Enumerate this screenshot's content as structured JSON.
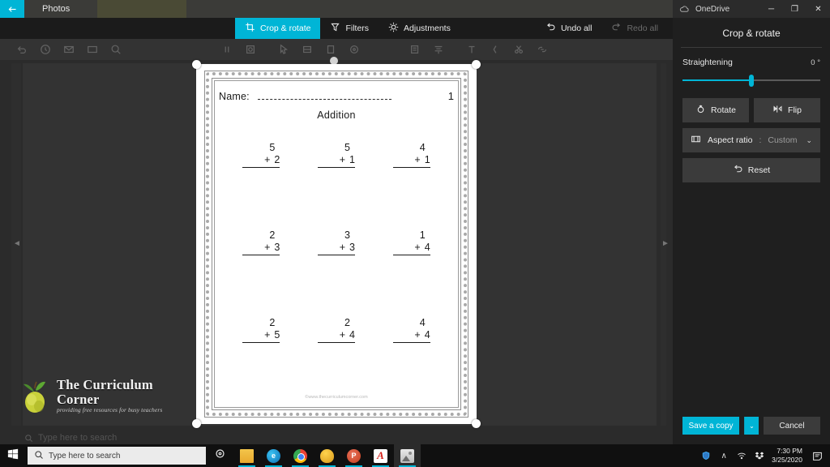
{
  "background_window": {
    "title": "",
    "toolbar_icons": [
      "undo-icon",
      "clock-icon",
      "mail-icon",
      "envelope-icon",
      "search-icon",
      "pause-icon",
      "stamp-icon",
      "cursor-icon",
      "shape-icon",
      "target-icon",
      "note-icon",
      "text-icon",
      "align-icon",
      "bracket-icon",
      "scissors-icon",
      "link-icon"
    ],
    "zoom_label": "",
    "search_ghost_placeholder": "Type here to search"
  },
  "photos": {
    "back_label": "←",
    "app_name": "Photos",
    "tools": [
      {
        "label": "Crop & rotate",
        "icon": "crop-icon",
        "active": true
      },
      {
        "label": "Filters",
        "icon": "filters-icon",
        "active": false
      },
      {
        "label": "Adjustments",
        "icon": "brightness-icon",
        "active": false
      }
    ],
    "actions": [
      {
        "label": "Undo all",
        "icon": "undo-icon",
        "disabled": false
      },
      {
        "label": "Redo all",
        "icon": "redo-icon",
        "disabled": true
      }
    ]
  },
  "worksheet": {
    "name_label": "Name:",
    "name_value": "",
    "page_number": "1",
    "title": "Addition",
    "footer": "©www.thecurriculumcorner.com",
    "rows": [
      [
        {
          "top": "5",
          "op": "+",
          "bottom": "2"
        },
        {
          "top": "5",
          "op": "+",
          "bottom": "1"
        },
        {
          "top": "4",
          "op": "+",
          "bottom": "1"
        }
      ],
      [
        {
          "top": "2",
          "op": "+",
          "bottom": "3"
        },
        {
          "top": "3",
          "op": "+",
          "bottom": "3"
        },
        {
          "top": "1",
          "op": "+",
          "bottom": "4"
        }
      ],
      [
        {
          "top": "2",
          "op": "+",
          "bottom": "5"
        },
        {
          "top": "2",
          "op": "+",
          "bottom": "4"
        },
        {
          "top": "4",
          "op": "+",
          "bottom": "4"
        }
      ]
    ]
  },
  "watermark": {
    "title": "The Curriculum Corner",
    "tagline": "providing free resources for busy teachers",
    "logo": "apple-icon"
  },
  "side_panel": {
    "window": {
      "app_label": "OneDrive",
      "icon": "onedrive-cloud-icon",
      "minimize": "─",
      "maximize": "❐",
      "close": "✕"
    },
    "header": "Crop & rotate",
    "straightening": {
      "label": "Straightening",
      "value": "0 °",
      "percent": 50
    },
    "buttons": [
      {
        "label": "Rotate",
        "icon": "rotate-icon"
      },
      {
        "label": "Flip",
        "icon": "flip-icon"
      }
    ],
    "aspect_ratio": {
      "label": "Aspect ratio",
      "separator": ":",
      "value": "Custom",
      "icon": "aspect-ratio-icon",
      "chevron": "⌄"
    },
    "reset": {
      "label": "Reset",
      "icon": "reset-icon"
    },
    "footer_buttons": {
      "save": "Save a copy",
      "save_caret": "⌄",
      "cancel": "Cancel"
    }
  },
  "taskbar": {
    "start_icon": "windows-logo-icon",
    "search": {
      "placeholder": "Type here to search",
      "icon": "search-icon"
    },
    "cortana_icon": "cortana-circle-icon",
    "apps": [
      {
        "name": "file-explorer",
        "icon": "folder-icon",
        "active": false,
        "running": true
      },
      {
        "name": "microsoft-edge",
        "icon": "edge-icon",
        "active": false,
        "running": true
      },
      {
        "name": "google-chrome",
        "icon": "chrome-icon",
        "active": false,
        "running": true
      },
      {
        "name": "amber-app",
        "icon": "amber-icon",
        "active": false,
        "running": true
      },
      {
        "name": "powerpoint",
        "icon": "powerpoint-icon",
        "active": false,
        "running": true
      },
      {
        "name": "adobe-acrobat",
        "icon": "acrobat-icon",
        "active": false,
        "running": true
      },
      {
        "name": "photos",
        "icon": "photos-icon",
        "active": true,
        "running": true
      }
    ],
    "tray": {
      "show_hidden": "∧",
      "network_icon": "wifi-icon",
      "dropbox_icon": "dropbox-icon",
      "defender_icon": "shield-icon",
      "time": "7:30 PM",
      "date": "3/25/2020",
      "notifications_icon": "action-center-icon"
    }
  },
  "colors": {
    "accent": "#00b5d6",
    "panel_bg": "#1f1f1f",
    "toolbar_bg": "#1b1b1b",
    "button_bg": "#3b3b3b",
    "taskbar_bg": "#101010"
  }
}
